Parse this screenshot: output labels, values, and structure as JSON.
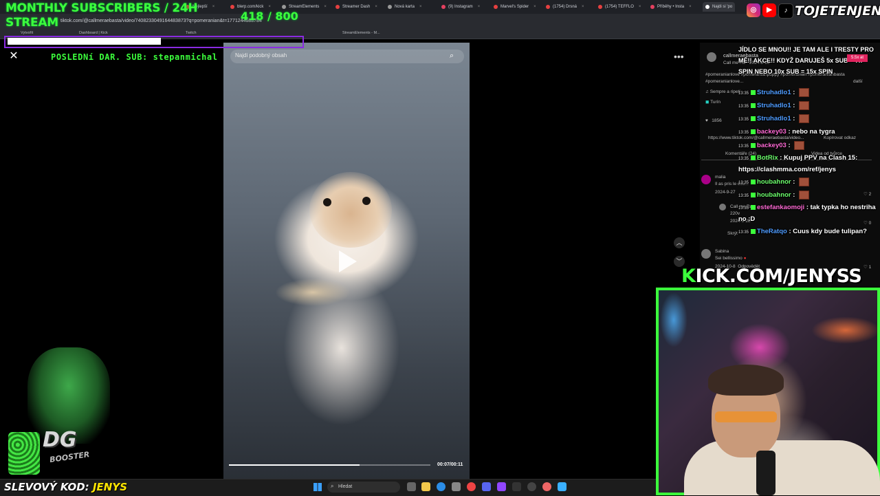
{
  "overlay": {
    "title_line1": "MONTHLY SUBSCRIBERS / 24H",
    "title_line2": "STREAM",
    "count": "418 / 800",
    "progress_fraction": 0.5225,
    "last_donation": "POSLEDNí DAR. SUB: stepanmichal",
    "social_handle": "TOJETENJENYS",
    "kick_url": "KICK.COM/JENYSS",
    "discount_label": "SLEVOVÝ KOD: ",
    "discount_code": "JENYS",
    "booster_brand": "DG",
    "booster_sub": "BOOSTER"
  },
  "browser": {
    "url": "tiktok.com/@callmeraebasta/video/7408233049164483873?q=pomeranian&t=1771244688784",
    "tabs": [
      "Nejlepší",
      "blerp.com/kick",
      "StreamElements",
      "Streamer Dash",
      "Nová karta",
      "(9) Instagram",
      "Marvel's Spider",
      "(1754) Drsná",
      "(1754) TEFFLO",
      "Příběhy • Insta",
      "Najdi si 'po"
    ],
    "bookmarks": [
      "Vytvořit"
    ],
    "bookmarks_tail": [
      "Dashboard | Kick",
      "Twitch",
      "StreamElements - M..."
    ]
  },
  "video": {
    "search_placeholder": "Najdi podobný obsah",
    "time": "00:07/00:11",
    "progress_fraction": 0.65
  },
  "page_right": {
    "author": "callmeraebasta",
    "author_sub": "Call me Ra · 2024-8-28",
    "hashtags": "#pomeranianlove #pomeranianpuppy #pomeranian #pomeranianbasta #pomeranianlove...",
    "more": "další",
    "sound": "Sempre a ripeti",
    "location": "Turín",
    "likes": "1856",
    "link": "https://www.tiktok.com/@callmeraebasta/video...",
    "copy_link": "Kopírovat odkaz",
    "comments_tab": "Komentáře (24)",
    "creator_videos_tab": "Videa od tvůrce",
    "comments": [
      {
        "user": "malia",
        "text": "Il as pris le cou...",
        "date": "2024-9-27",
        "likes": "2"
      },
      {
        "user": "Call me Ra",
        "text": "220v",
        "date": "2024-9-28",
        "likes": "0"
      },
      {
        "user": "Sabina",
        "text": "Sei bellissimo",
        "date": "2024-10-8",
        "reply": "Odpovědět",
        "likes": "1"
      }
    ],
    "hide": "Skrýt"
  },
  "chat": {
    "top_message": "JÍDLO SE MNOU!! JE TAM ALE I TRESTY PRO MĚ!! AKCE!! KDYŽ DARUJEŠ 5x SUB = 7x SPIN NEBO 10x SUB = 15x SPIN",
    "gift_badge": "5.5x at",
    "lines": [
      {
        "time": "13:35",
        "user": "Struhadlo1",
        "msg": "",
        "color": "blue"
      },
      {
        "time": "13:35",
        "user": "Struhadlo1",
        "msg": "",
        "color": "blue"
      },
      {
        "time": "13:35",
        "user": "Struhadlo1",
        "msg": "",
        "color": "blue"
      },
      {
        "time": "13:35",
        "user": "backey03",
        "msg": "nebo na tygra",
        "color": "pink"
      },
      {
        "time": "13:35",
        "user": "backey03",
        "msg": "",
        "color": "pink"
      },
      {
        "time": "13:35",
        "user": "BotRix",
        "msg": "Kupuj PPV na Clash 15: https://clashmma.com/ref/jenys",
        "color": "green"
      },
      {
        "time": "13:35",
        "user": "houbahnor",
        "msg": "",
        "color": "green"
      },
      {
        "time": "13:35",
        "user": "houbahnor",
        "msg": "",
        "color": "green"
      },
      {
        "time": "13:35",
        "user": "estefankaomoji",
        "msg": "tak typka ho nestriha no :D",
        "color": "pink"
      },
      {
        "time": "13:35",
        "user": "TheRatqo",
        "msg": "Cuus kdy bude tulipan?",
        "color": "blue"
      }
    ]
  },
  "taskbar": {
    "search_label": "Hledat"
  },
  "colors": {
    "overlay_green": "#3cff3c",
    "progress_border": "#8a2be2",
    "kick_green": "#3cff3c",
    "discount_yellow": "#ffe600"
  },
  "icons": [
    "close-icon",
    "search-icon",
    "play-icon",
    "more-icon",
    "chevron-up-icon",
    "chevron-down-icon",
    "instagram-icon",
    "youtube-icon",
    "tiktok-icon",
    "windows-icon",
    "heart-icon"
  ]
}
